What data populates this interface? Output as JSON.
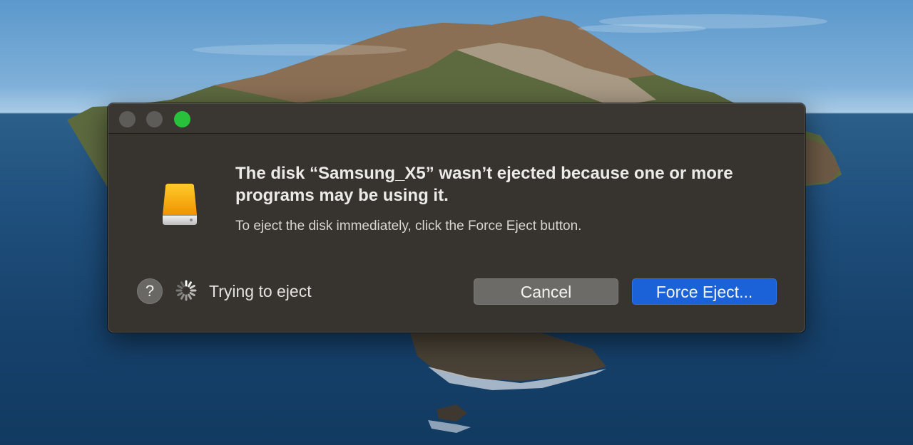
{
  "dialog": {
    "heading": "The disk “Samsung_X5” wasn’t ejected because one or more programs may be using it.",
    "message": "To eject the disk immediately, click the Force Eject button.",
    "status_text": "Trying to eject",
    "help_label": "?",
    "cancel_label": "Cancel",
    "force_eject_label": "Force Eject...",
    "icon": "external-disk-icon"
  },
  "window_controls": [
    "close",
    "minimize",
    "zoom"
  ],
  "colors": {
    "accent": "#1b62d8",
    "dialog_background": "#37342f",
    "zoom_button": "#29c13b",
    "disk_orange": "#f2a900"
  }
}
